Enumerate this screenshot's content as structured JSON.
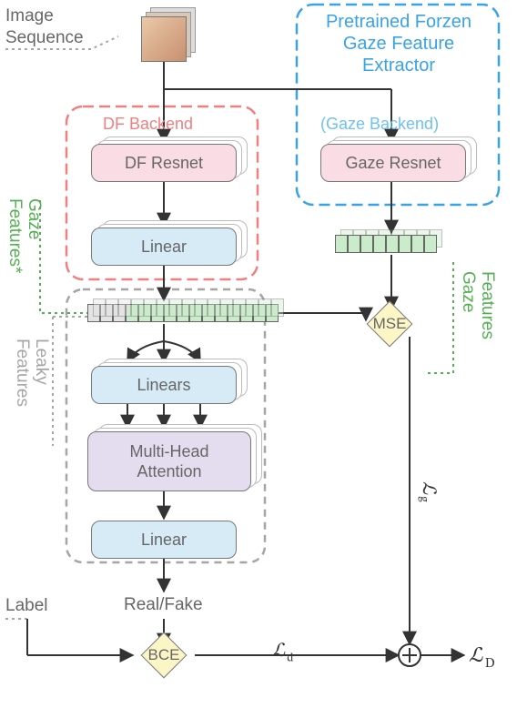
{
  "inputs": {
    "image_sequence": "Image\nSequence",
    "label": "Label"
  },
  "gaze_extractor": {
    "title": "Pretrained Forzen\nGaze Feature\nExtractor",
    "backend_label": "(Gaze Backend)",
    "resnet": "Gaze Resnet"
  },
  "df_backend": {
    "label": "DF Backend",
    "resnet": "DF Resnet",
    "linear": "Linear"
  },
  "attn_stack": {
    "linears": "Linears",
    "mha": "Multi-Head\nAttention",
    "linear": "Linear"
  },
  "outputs": {
    "realfake": "Real/Fake"
  },
  "losses": {
    "mse": "MSE",
    "bce": "BCE",
    "Ld_small": "ℒ",
    "Ld_small_sub": "d",
    "Lg": "ℒ",
    "Lg_sub": "g",
    "LD": "ℒ",
    "LD_sub": "D"
  },
  "feat_labels": {
    "gaze_star_1": "Gaze",
    "gaze_star_2": "Features*",
    "leaky_1": "Leaky",
    "leaky_2": "Features",
    "gaze_1": "Gaze",
    "gaze_2": "Features"
  },
  "colors": {
    "green_dash": "#54b053",
    "grey_dash": "#a6a6a6",
    "red_dash": "#f07f80",
    "blue_dash": "#3aa3e6"
  }
}
